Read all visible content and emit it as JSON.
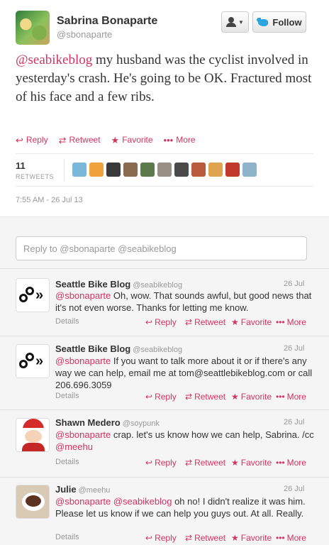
{
  "tweet": {
    "author_name": "Sabrina Bonaparte",
    "author_handle": "@sbonaparte",
    "follow_label": "Follow",
    "mention": "@seabikeblog",
    "text": " my husband was the cyclist involved in yesterday's crash. He's going to be OK. Fractured most of his face and a few ribs.",
    "actions": {
      "reply": "Reply",
      "retweet": "Retweet",
      "favorite": "Favorite",
      "more": "More"
    },
    "retweet_count": "11",
    "retweet_label": "RETWEETS",
    "retweeter_avatar_colors": [
      "#7ab8d9",
      "#f2a23a",
      "#3a3a3a",
      "#8a6b4f",
      "#5c7a4a",
      "#9a8f86",
      "#4a4a4a",
      "#b85c3c",
      "#e0a44f",
      "#c0392b",
      "#8fb3c9"
    ],
    "timestamp": "7:55 AM - 26 Jul 13"
  },
  "reply_box": {
    "placeholder": "Reply to @sbonaparte @seabikeblog"
  },
  "replies": [
    {
      "name": "Seattle Bike Blog",
      "handle": "@seabikeblog",
      "date": "26 Jul",
      "mentions": "@sbonaparte",
      "text": " Oh, wow. That sounds awful, but good news that it's not even worse. Thanks for letting me know."
    },
    {
      "name": "Seattle Bike Blog",
      "handle": "@seabikeblog",
      "date": "26 Jul",
      "mentions": "@sbonaparte",
      "text": " If you want to talk more about it or if there's any way we can help, email me at tom@seattlebikeblog.com or call 206.696.3059"
    },
    {
      "name": "Shawn Medero",
      "handle": "@soypunk",
      "date": "26 Jul",
      "mentions": "@sbonaparte",
      "text": " crap. let's us know how we can help, Sabrina. /cc ",
      "mention_end": "@meehu"
    },
    {
      "name": "Julie",
      "handle": "@meehu",
      "date": "26 Jul",
      "mentions": "@sbonaparte @seabikeblog",
      "text": " oh no! I didn't realize it was him. Please let us know if we can help you guys out. At all. Really."
    }
  ],
  "reply_footer": {
    "details": "Details",
    "reply": "Reply",
    "retweet": "Retweet",
    "favorite": "Favorite",
    "more": "More"
  },
  "colors": {
    "accent": "#d0345f",
    "twitter_blue": "#2ba5de",
    "muted": "#999999"
  }
}
